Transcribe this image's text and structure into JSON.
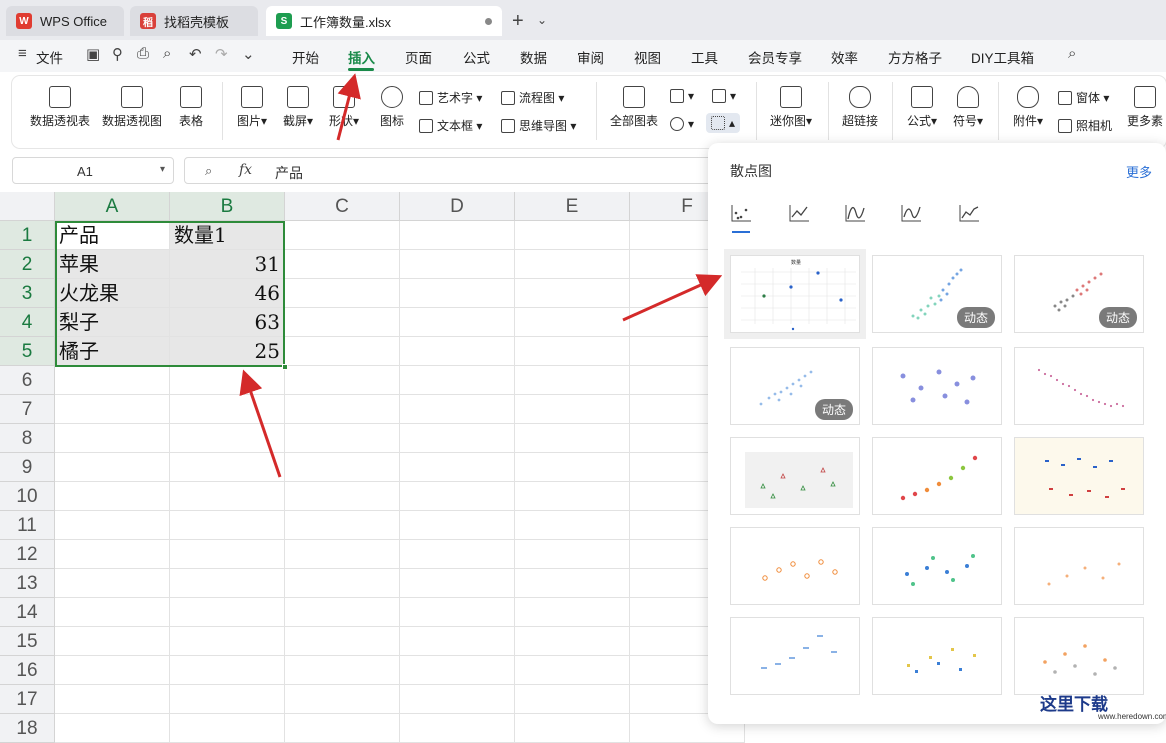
{
  "tabs": [
    {
      "label": "WPS Office",
      "color": "#e03c31",
      "glyph": "W"
    },
    {
      "label": "找稻壳模板",
      "color": "#d9403a",
      "glyph": "稻"
    },
    {
      "label": "工作簿数量.xlsx",
      "color": "#1e9d50",
      "glyph": "S"
    }
  ],
  "menu": {
    "file": "文件",
    "items": [
      "开始",
      "插入",
      "页面",
      "公式",
      "数据",
      "审阅",
      "视图",
      "工具",
      "会员专享",
      "效率",
      "方方格子",
      "DIY工具箱"
    ],
    "active": "插入"
  },
  "ribbon": {
    "pivot_table": "数据透视表",
    "pivot_chart": "数据透视图",
    "table": "表格",
    "picture": "图片",
    "screenshot": "截屏",
    "shape": "形状",
    "icon": "图标",
    "wordart": "艺术字",
    "textbox": "文本框",
    "flowchart": "流程图",
    "mindmap": "思维导图",
    "all_charts": "全部图表",
    "sparkline": "迷你图",
    "hyperlink": "超链接",
    "formula": "公式",
    "symbol": "符号",
    "attachment": "附件",
    "form": "窗体",
    "camera": "照相机",
    "more": "更多素"
  },
  "formula_bar": {
    "cell_ref": "A1",
    "fx": "fx",
    "value": "产品"
  },
  "sheet": {
    "columns": [
      "A",
      "B",
      "C",
      "D",
      "E",
      "F"
    ],
    "rows": [
      "1",
      "2",
      "3",
      "4",
      "5",
      "6",
      "7",
      "8",
      "9",
      "10",
      "11",
      "12",
      "13",
      "14",
      "15",
      "16",
      "17",
      "18"
    ],
    "data": [
      [
        "产品",
        "数量1"
      ],
      [
        "苹果",
        "31"
      ],
      [
        "火龙果",
        "46"
      ],
      [
        "梨子",
        "63"
      ],
      [
        "橘子",
        "25"
      ]
    ]
  },
  "panel": {
    "title": "散点图",
    "more": "更多",
    "dynamic_badge": "动态",
    "selected_chart_title": "数量"
  },
  "watermark": {
    "text": "这里下载",
    "url": "www.heredown.com"
  },
  "colors": {
    "accent": "#1a8a4a",
    "arrow": "#d42a2a",
    "link": "#2a6fd6"
  }
}
